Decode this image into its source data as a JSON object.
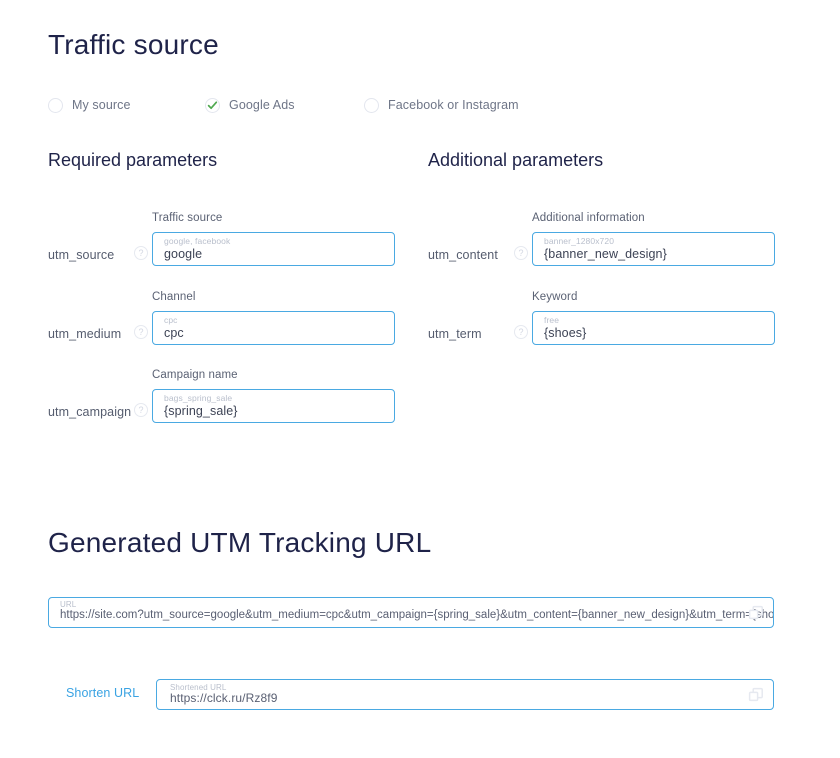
{
  "headings": {
    "traffic_source": "Traffic source",
    "generated_url": "Generated UTM Tracking URL",
    "required_parameters": "Required parameters",
    "additional_parameters": "Additional parameters"
  },
  "source_options": [
    {
      "label": "My source",
      "selected": false,
      "icon": "radio-empty-icon"
    },
    {
      "label": "Google Ads",
      "selected": true,
      "icon": "check-icon"
    },
    {
      "label": "Facebook or Instagram",
      "selected": false,
      "icon": "radio-empty-icon"
    }
  ],
  "required_fields": [
    {
      "param": "utm_source",
      "caption": "Traffic source",
      "placeholder": "google, facebook",
      "value": "google",
      "help": "?"
    },
    {
      "param": "utm_medium",
      "caption": "Channel",
      "placeholder": "cpc",
      "value": "cpc",
      "help": "?"
    },
    {
      "param": "utm_campaign",
      "caption": "Campaign name",
      "placeholder": "bags_spring_sale",
      "value": "{spring_sale}",
      "help": "?"
    }
  ],
  "additional_fields": [
    {
      "param": "utm_content",
      "caption": "Additional information",
      "placeholder": "banner_1280x720",
      "value": "{banner_new_design}",
      "help": "?"
    },
    {
      "param": "utm_term",
      "caption": "Keyword",
      "placeholder": "free",
      "value": "{shoes}",
      "help": "?"
    }
  ],
  "generated": {
    "url_placeholder": "URL",
    "url_value": "https://site.com?utm_source=google&utm_medium=cpc&utm_campaign={spring_sale}&utm_content={banner_new_design}&utm_term={shoes}",
    "copy_icon": "copy-icon",
    "shorten_link": "Shorten URL",
    "short_placeholder": "Shortened URL",
    "short_value": "https://clck.ru/Rz8f9",
    "short_copy_icon": "copy-icon"
  },
  "colors": {
    "heading": "#1f2349",
    "input_border": "#4aa9e2",
    "link": "#3aa3e3",
    "check": "#4fa84f",
    "muted_text": "#6e7587",
    "placeholder": "#b9bfcc"
  }
}
